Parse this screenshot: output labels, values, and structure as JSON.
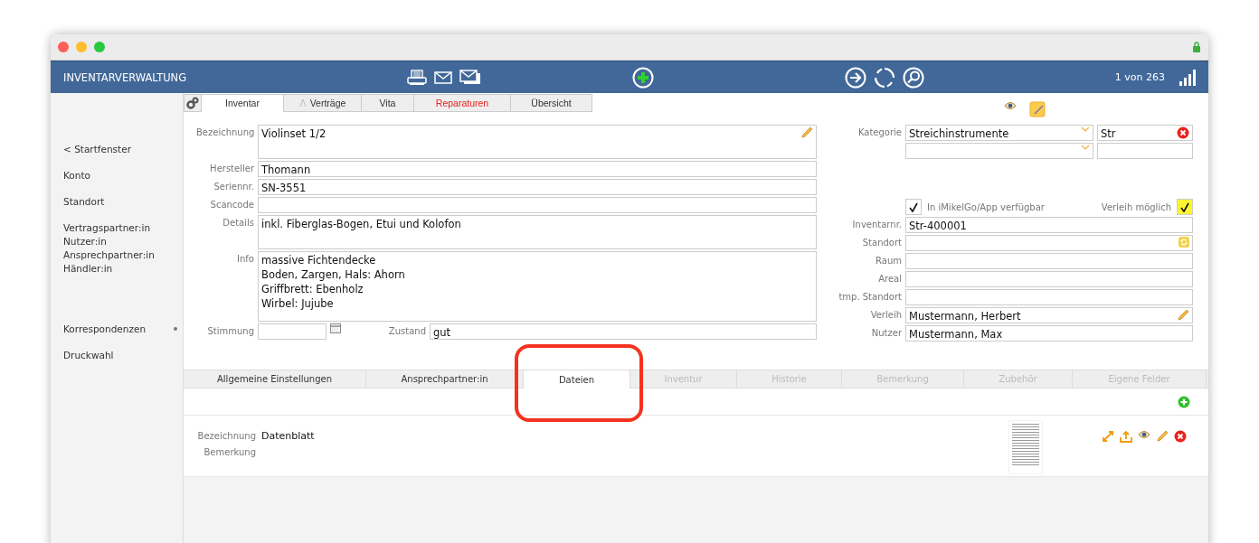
{
  "toolbar": {
    "title": "INVENTARVERWALTUNG",
    "record_counter": "1 von 263"
  },
  "sidebar": {
    "groups": [
      {
        "items": [
          {
            "label": "< Startfenster",
            "marker": false
          }
        ]
      },
      {
        "items": [
          {
            "label": "Konto",
            "marker": false
          }
        ]
      },
      {
        "items": [
          {
            "label": "Standort",
            "marker": false
          }
        ]
      },
      {
        "items": [
          {
            "label": "Vertragspartner:in",
            "marker": false
          },
          {
            "label": "Nutzer:in",
            "marker": false
          },
          {
            "label": "Ansprechpartner:in",
            "marker": false
          },
          {
            "label": "Händler:in",
            "marker": false
          }
        ]
      },
      {
        "items": [
          {
            "label": "Korrespondenzen",
            "marker": true
          }
        ]
      },
      {
        "items": [
          {
            "label": "Druckwahl",
            "marker": false
          }
        ]
      }
    ]
  },
  "tabs": [
    {
      "label": "Inventar",
      "selected": true,
      "highlighted": false,
      "has_icon": false
    },
    {
      "label": "Verträge",
      "selected": false,
      "highlighted": false,
      "has_icon": true
    },
    {
      "label": "Vita",
      "selected": false,
      "highlighted": false,
      "has_icon": false
    },
    {
      "label": "Reparaturen",
      "selected": false,
      "highlighted": true,
      "has_icon": false
    },
    {
      "label": "Übersicht",
      "selected": false,
      "highlighted": false,
      "has_icon": false
    }
  ],
  "left_fields": [
    {
      "kind": "area",
      "label": "Bezeichnung",
      "value": "Violinset 1/2",
      "editable": true
    },
    {
      "kind": "text",
      "label": "Hersteller",
      "value": "Thomann"
    },
    {
      "kind": "text",
      "label": "Seriennr.",
      "value": "SN-3551"
    },
    {
      "kind": "text",
      "label": "Scancode"
    },
    {
      "kind": "area",
      "label": "Details",
      "value": "inkl. Fiberglas-Bogen, Etui und Kolofon"
    },
    {
      "kind": "tall",
      "label": "Info",
      "value": "massive Fichtendecke\nBoden, Zargen, Hals: Ahorn\nGriffbrett: Ebenholz\nWirbel: Jujube"
    }
  ],
  "tuning": {
    "label": "Stimmung"
  },
  "condition": {
    "label": "Zustand",
    "value": "gut"
  },
  "category": {
    "label": "Kategorie",
    "value": "Streichinstrumente",
    "code": "Str"
  },
  "flags": [
    {
      "kind": "leading",
      "label": "In iMikelGo/App verfügbar",
      "checked": true,
      "color": "#ffffff"
    },
    {
      "kind": "trailing",
      "label": "Verleih möglich",
      "checked": true,
      "color": "#fbf431"
    }
  ],
  "right_fields": [
    {
      "kind": "text",
      "label": "Inventarnr.",
      "value": "Str-400001"
    },
    {
      "kind": "text",
      "label": "Standort",
      "refreshable": true
    },
    {
      "kind": "text",
      "label": "Raum"
    },
    {
      "kind": "text",
      "label": "Areal"
    },
    {
      "kind": "text",
      "label": "tmp. Standort"
    },
    {
      "kind": "text",
      "label": "Verleih",
      "value": "Mustermann, Herbert",
      "editable": true
    },
    {
      "kind": "text",
      "label": "Nutzer",
      "value": "Mustermann, Max"
    }
  ],
  "bottom_tabs": [
    {
      "label": "Allgemeine Einstellungen",
      "selected": false,
      "disabled": false
    },
    {
      "label": "Ansprechpartner:in",
      "selected": false,
      "disabled": false
    },
    {
      "label": "Dateien",
      "selected": true,
      "disabled": false
    },
    {
      "label": "Inventur",
      "selected": false,
      "disabled": true
    },
    {
      "label": "Historie",
      "selected": false,
      "disabled": true
    },
    {
      "label": "Bemerkung",
      "selected": false,
      "disabled": true
    },
    {
      "label": "Zubehör",
      "selected": false,
      "disabled": true
    },
    {
      "label": "Eigene Felder",
      "selected": false,
      "disabled": true
    }
  ],
  "files": [
    {
      "fields": [
        {
          "label": "Bezeichnung",
          "value": "Datenblatt"
        },
        {
          "label": "Bemerkung"
        }
      ]
    }
  ]
}
